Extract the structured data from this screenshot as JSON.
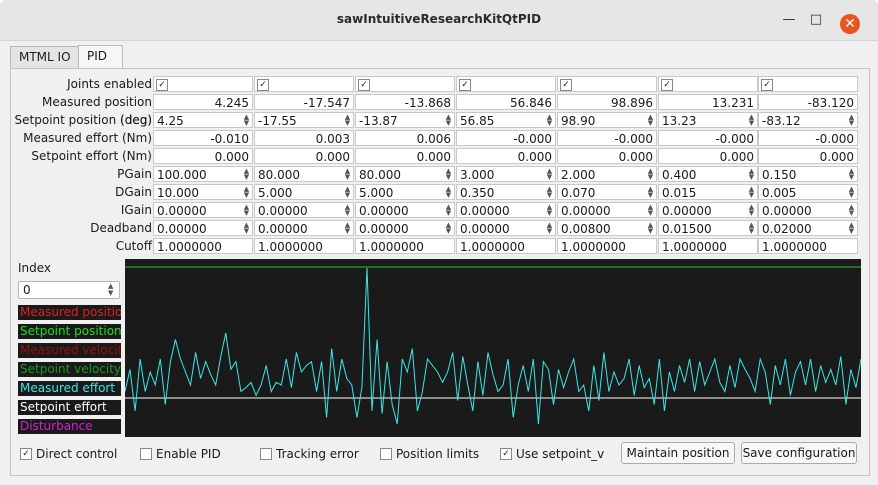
{
  "window": {
    "title": "sawIntuitiveResearchKitQtPID",
    "min": "—",
    "max": "□",
    "close": "✕"
  },
  "tabs": [
    {
      "label": "MTML IO"
    },
    {
      "label": "PID"
    }
  ],
  "rows": {
    "joints_enabled": {
      "label": "Joints enabled",
      "checked": [
        true,
        true,
        true,
        true,
        true,
        true,
        true
      ]
    },
    "measured_position": {
      "label": "Measured position (deg)",
      "values": [
        "4.245",
        "-17.547",
        "-13.868",
        "56.846",
        "98.896",
        "13.231",
        "-83.120"
      ]
    },
    "setpoint_position": {
      "label": "Setpoint position (deg)",
      "values": [
        "4.25",
        "-17.55",
        "-13.87",
        "56.85",
        "98.90",
        "13.23",
        "-83.12"
      ]
    },
    "measured_effort": {
      "label": "Measured effort (Nm)",
      "values": [
        "-0.010",
        "0.003",
        "0.006",
        "-0.000",
        "-0.000",
        "-0.000",
        "-0.000"
      ]
    },
    "setpoint_effort": {
      "label": "Setpoint effort (Nm)",
      "values": [
        "0.000",
        "0.000",
        "0.000",
        "0.000",
        "0.000",
        "0.000",
        "0.000"
      ]
    },
    "pgain": {
      "label": "PGain",
      "values": [
        "100.000",
        "80.000",
        "80.000",
        "3.000",
        "2.000",
        "0.400",
        "0.150"
      ]
    },
    "dgain": {
      "label": "DGain",
      "values": [
        "10.000",
        "5.000",
        "5.000",
        "0.350",
        "0.070",
        "0.015",
        "0.005"
      ]
    },
    "igain": {
      "label": "IGain",
      "values": [
        "0.00000",
        "0.00000",
        "0.00000",
        "0.00000",
        "0.00000",
        "0.00000",
        "0.00000"
      ]
    },
    "deadband": {
      "label": "Deadband",
      "values": [
        "0.00000",
        "0.00000",
        "0.00000",
        "0.00000",
        "0.00800",
        "0.01500",
        "0.02000"
      ]
    },
    "cutoff": {
      "label": "Cutoff",
      "values": [
        "1.0000000",
        "1.0000000",
        "1.0000000",
        "1.0000000",
        "1.0000000",
        "1.0000000",
        "1.0000000"
      ]
    }
  },
  "index": {
    "label": "Index",
    "value": "0"
  },
  "legend": [
    {
      "label": "Measured position",
      "color": "#e02020"
    },
    {
      "label": "Setpoint position",
      "color": "#22dd22"
    },
    {
      "label": "Measured velocity",
      "color": "#9a1010"
    },
    {
      "label": "Setpoint velocity",
      "color": "#1f9a1f"
    },
    {
      "label": "Measured effort",
      "color": "#39e6e6"
    },
    {
      "label": "Setpoint effort",
      "color": "#ffffff"
    },
    {
      "label": "Disturbance",
      "color": "#d020d0"
    }
  ],
  "plot": {
    "setpoint_line_color": "#22cc22",
    "effort_baseline_color": "#ffffff",
    "effort_color": "#39e6e6",
    "effort_trace": [
      0.05,
      0.22,
      -0.1,
      0.3,
      0.05,
      0.2,
      0.1,
      0.3,
      -0.05,
      0.28,
      0.45,
      0.3,
      0.2,
      0.1,
      0.35,
      0.15,
      0.28,
      0.18,
      0.1,
      0.32,
      0.5,
      0.22,
      0.28,
      0.05,
      0.08,
      0.12,
      0.02,
      0.1,
      0.25,
      0.05,
      0.12,
      0.1,
      0.3,
      0.08,
      0.35,
      0.2,
      0.25,
      0.28,
      0.05,
      0.28,
      -0.15,
      0.38,
      0.05,
      0.3,
      0.15,
      0.1,
      -0.15,
      0.08,
      1.0,
      -0.1,
      0.45,
      -0.12,
      0.28,
      -0.05,
      -0.2,
      0.3,
      0.2,
      0.38,
      -0.1,
      0.05,
      0.3,
      0.25,
      0.2,
      0.12,
      0.2,
      0.35,
      -0.02,
      0.32,
      0.1,
      -0.1,
      0.28,
      0.02,
      0.35,
      0.18,
      0.05,
      0.1,
      0.3,
      -0.15,
      0.1,
      0.25,
      0.05,
      0.3,
      -0.2,
      0.28,
      0.22,
      -0.05,
      0.22,
      0.08,
      0.2,
      0.3,
      0.05,
      0.1,
      -0.1,
      0.25,
      -0.02,
      0.35,
      0.05,
      0.2,
      0.1,
      0.15,
      0.3,
      0.02,
      0.25,
      0.08,
      0.15,
      -0.05,
      0.3,
      -0.1,
      0.2,
      0.05,
      0.25,
      0.12,
      0.3,
      0.05,
      0.28,
      0.1,
      0.2,
      0.3,
      0.12,
      0.05,
      0.25,
      0.08,
      0.3,
      0.22,
      0.15,
      0.05,
      0.3,
      0.2,
      -0.05,
      0.25,
      0.1,
      0.3,
      0.02,
      0.2,
      0.28,
      0.1,
      0.3,
      0.05,
      0.25,
      0.12,
      0.22,
      0.1,
      0.32,
      -0.05,
      0.22,
      0.08,
      0.3
    ]
  },
  "bottom": {
    "direct_control": {
      "label": "Direct control",
      "checked": true
    },
    "enable_pid": {
      "label": "Enable PID",
      "checked": false
    },
    "tracking_error": {
      "label": "Tracking error",
      "checked": false
    },
    "position_limits": {
      "label": "Position limits",
      "checked": false
    },
    "use_setpoint_v": {
      "label": "Use setpoint_v",
      "checked": true
    },
    "maintain_position": "Maintain position",
    "save_configuration": "Save configuration"
  }
}
